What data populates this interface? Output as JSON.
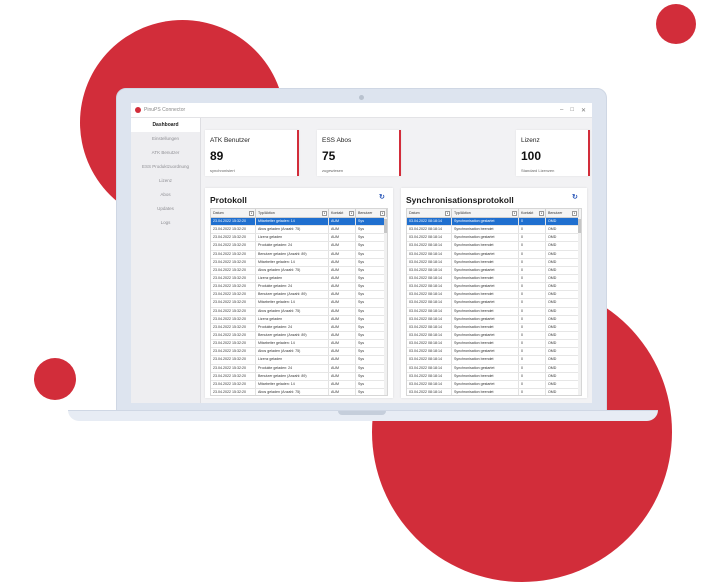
{
  "app": {
    "title": "PinuPS Connector",
    "win_min": "–",
    "win_max": "□",
    "win_close": "✕"
  },
  "sidebar": {
    "items": [
      {
        "label": "Dashboard",
        "active": true
      },
      {
        "label": "Einstellungen"
      },
      {
        "label": "ATK Benutzer"
      },
      {
        "label": "ESS Produktzuordnung"
      },
      {
        "label": "Lizenz"
      },
      {
        "label": "Abos"
      },
      {
        "label": "Updates"
      },
      {
        "label": "Logs"
      }
    ]
  },
  "cards": [
    {
      "title": "ATK Benutzer",
      "value": "89",
      "sub": "synchronisiert"
    },
    {
      "title": "ESS Abos",
      "value": "75",
      "sub": "zugewiesen"
    },
    {
      "title": "Lizenz",
      "value": "100",
      "sub": "Standard Lizenzen"
    }
  ],
  "protokoll": {
    "title": "Protokoll",
    "refresh_icon": "refresh-icon",
    "columns": [
      "Datum",
      "Typ/Aktion",
      "Kontakt",
      "Benutzer"
    ],
    "rows": [
      [
        "23.04.2022 15:32:20",
        "Mitarbeiter geladen: 14",
        "AUM",
        "Sys"
      ],
      [
        "23.04.2022 15:32:20",
        "Abos geladen (Anzahl: 75)",
        "AUM",
        "Sys"
      ],
      [
        "23.04.2022 15:32:20",
        "Lizenz geladen",
        "AUM",
        "Sys"
      ],
      [
        "23.04.2022 15:32:20",
        "Produkte geladen: 24",
        "AUM",
        "Sys"
      ],
      [
        "23.04.2022 15:32:20",
        "Benutzer geladen (Anzahl: 89)",
        "AUM",
        "Sys"
      ],
      [
        "23.04.2022 15:32:20",
        "Mitarbeiter geladen: 14",
        "AUM",
        "Sys"
      ],
      [
        "23.04.2022 15:32:20",
        "Abos geladen (Anzahl: 75)",
        "AUM",
        "Sys"
      ],
      [
        "23.04.2022 15:32:20",
        "Lizenz geladen",
        "AUM",
        "Sys"
      ],
      [
        "23.04.2022 15:32:20",
        "Produkte geladen: 24",
        "AUM",
        "Sys"
      ],
      [
        "23.04.2022 15:32:20",
        "Benutzer geladen (Anzahl: 89)",
        "AUM",
        "Sys"
      ],
      [
        "23.04.2022 15:32:20",
        "Mitarbeiter geladen: 14",
        "AUM",
        "Sys"
      ],
      [
        "23.04.2022 15:32:20",
        "Abos geladen (Anzahl: 75)",
        "AUM",
        "Sys"
      ],
      [
        "23.04.2022 15:32:20",
        "Lizenz geladen",
        "AUM",
        "Sys"
      ],
      [
        "23.04.2022 15:32:20",
        "Produkte geladen: 24",
        "AUM",
        "Sys"
      ],
      [
        "23.04.2022 15:32:20",
        "Benutzer geladen (Anzahl: 89)",
        "AUM",
        "Sys"
      ],
      [
        "23.04.2022 15:32:20",
        "Mitarbeiter geladen: 14",
        "AUM",
        "Sys"
      ],
      [
        "23.04.2022 15:32:20",
        "Abos geladen (Anzahl: 75)",
        "AUM",
        "Sys"
      ],
      [
        "23.04.2022 15:32:20",
        "Lizenz geladen",
        "AUM",
        "Sys"
      ],
      [
        "23.04.2022 15:32:20",
        "Produkte geladen: 24",
        "AUM",
        "Sys"
      ],
      [
        "23.04.2022 15:32:20",
        "Benutzer geladen (Anzahl: 89)",
        "AUM",
        "Sys"
      ],
      [
        "23.04.2022 15:32:20",
        "Mitarbeiter geladen: 14",
        "AUM",
        "Sys"
      ],
      [
        "23.04.2022 15:32:20",
        "Abos geladen (Anzahl: 75)",
        "AUM",
        "Sys"
      ],
      [
        "23.04.2022 15:32:20",
        "Lizenz geladen",
        "AUM",
        "Sys"
      ],
      [
        "23.04.2022 15:32:20",
        "Produkte geladen: 24",
        "AUM",
        "Sys"
      ],
      [
        "23.04.2022 15:32:20",
        "Benutzer geladen (Anzahl: 89)",
        "AUM",
        "Sys"
      ]
    ]
  },
  "sync": {
    "title": "Synchronisationsprotokoll",
    "refresh_icon": "refresh-icon",
    "columns": [
      "Datum",
      "Typ/Aktion",
      "Kontakt",
      "Benutzer"
    ],
    "rows": [
      [
        "03.04.2022 08:18:14",
        "Synchronisation gestartet",
        "0",
        "OMD"
      ],
      [
        "03.04.2022 08:18:14",
        "Synchronisation beendet",
        "0",
        "OMD"
      ],
      [
        "03.04.2022 08:18:14",
        "Synchronisation gestartet",
        "0",
        "OMD"
      ],
      [
        "03.04.2022 08:18:14",
        "Synchronisation beendet",
        "0",
        "OMD"
      ],
      [
        "03.04.2022 08:18:14",
        "Synchronisation gestartet",
        "0",
        "OMD"
      ],
      [
        "03.04.2022 08:18:14",
        "Synchronisation beendet",
        "0",
        "OMD"
      ],
      [
        "03.04.2022 08:18:14",
        "Synchronisation gestartet",
        "0",
        "OMD"
      ],
      [
        "03.04.2022 08:18:14",
        "Synchronisation beendet",
        "0",
        "OMD"
      ],
      [
        "03.04.2022 08:18:14",
        "Synchronisation gestartet",
        "0",
        "OMD"
      ],
      [
        "03.04.2022 08:18:14",
        "Synchronisation beendet",
        "0",
        "OMD"
      ],
      [
        "03.04.2022 08:18:14",
        "Synchronisation gestartet",
        "0",
        "OMD"
      ],
      [
        "03.04.2022 08:18:14",
        "Synchronisation beendet",
        "0",
        "OMD"
      ],
      [
        "03.04.2022 08:18:14",
        "Synchronisation gestartet",
        "0",
        "OMD"
      ],
      [
        "03.04.2022 08:18:14",
        "Synchronisation beendet",
        "0",
        "OMD"
      ],
      [
        "03.04.2022 08:18:14",
        "Synchronisation gestartet",
        "0",
        "OMD"
      ],
      [
        "03.04.2022 08:18:14",
        "Synchronisation beendet",
        "0",
        "OMD"
      ],
      [
        "03.04.2022 08:18:14",
        "Synchronisation gestartet",
        "0",
        "OMD"
      ],
      [
        "03.04.2022 08:18:14",
        "Synchronisation beendet",
        "0",
        "OMD"
      ],
      [
        "03.04.2022 08:18:14",
        "Synchronisation gestartet",
        "0",
        "OMD"
      ],
      [
        "03.04.2022 08:18:14",
        "Synchronisation beendet",
        "0",
        "OMD"
      ],
      [
        "03.04.2022 08:18:14",
        "Synchronisation gestartet",
        "0",
        "OMD"
      ],
      [
        "03.04.2022 08:18:14",
        "Synchronisation beendet",
        "0",
        "OMD"
      ],
      [
        "03.04.2022 08:18:14",
        "Synchronisation gestartet",
        "0",
        "OMD"
      ],
      [
        "03.04.2022 08:18:14",
        "Synchronisation beendet",
        "0",
        "OMD"
      ],
      [
        "03.04.2022 08:18:14",
        "Synchronisation gestartet",
        "0",
        "OMD"
      ]
    ]
  },
  "colors": {
    "accent": "#d22d3a",
    "selection": "#1f6fcf"
  }
}
